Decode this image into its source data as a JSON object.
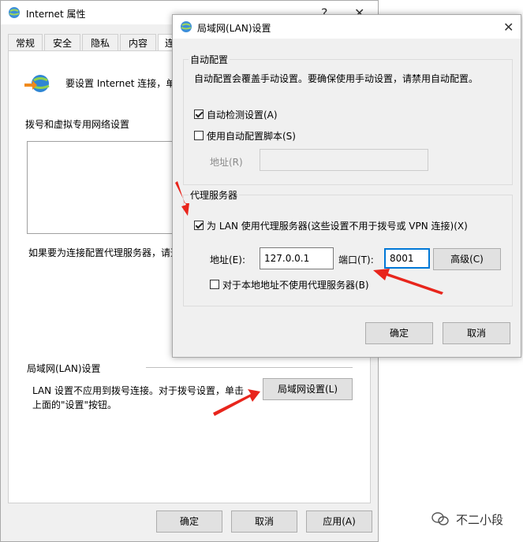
{
  "back": {
    "title": "Internet 属性",
    "help": "?",
    "close": "✕",
    "tabs": [
      "常规",
      "安全",
      "隐私",
      "内容",
      "连"
    ],
    "setup_text": "要设置 Internet 连接，单",
    "dialup_title": "拨号和虚拟专用网络设置",
    "proxy_hint": "如果要为连接配置代理服务器，请选",
    "lan_group_title": "局域网(LAN)设置",
    "lan_desc_1": "LAN 设置不应用到拨号连接。对于拨号设置，单击",
    "lan_desc_2": "上面的\"设置\"按钮。",
    "lan_button": "局域网设置(L)",
    "ok": "确定",
    "cancel": "取消",
    "apply": "应用(A)"
  },
  "lan": {
    "title": "局域网(LAN)设置",
    "close": "✕",
    "auto_config_title": "自动配置",
    "auto_config_desc": "自动配置会覆盖手动设置。要确保使用手动设置，请禁用自动配置。",
    "auto_detect": {
      "label": "自动检测设置(A)",
      "checked": true
    },
    "auto_script": {
      "label": "使用自动配置脚本(S)",
      "checked": false
    },
    "script_address_label": "地址(R)",
    "script_address_value": "",
    "proxy_title": "代理服务器",
    "use_proxy": {
      "label": "为 LAN 使用代理服务器(这些设置不用于拨号或 VPN 连接)(X)",
      "checked": true
    },
    "address_label": "地址(E):",
    "address_value": "127.0.0.1",
    "port_label": "端口(T):",
    "port_value": "8001",
    "advanced_button": "高级(C)",
    "bypass_local": {
      "label": "对于本地地址不使用代理服务器(B)",
      "checked": false
    },
    "ok": "确定",
    "cancel": "取消"
  },
  "watermark": "不二小段",
  "colors": {
    "arrow": "#e8251c",
    "input_focus": "#0078d7"
  }
}
